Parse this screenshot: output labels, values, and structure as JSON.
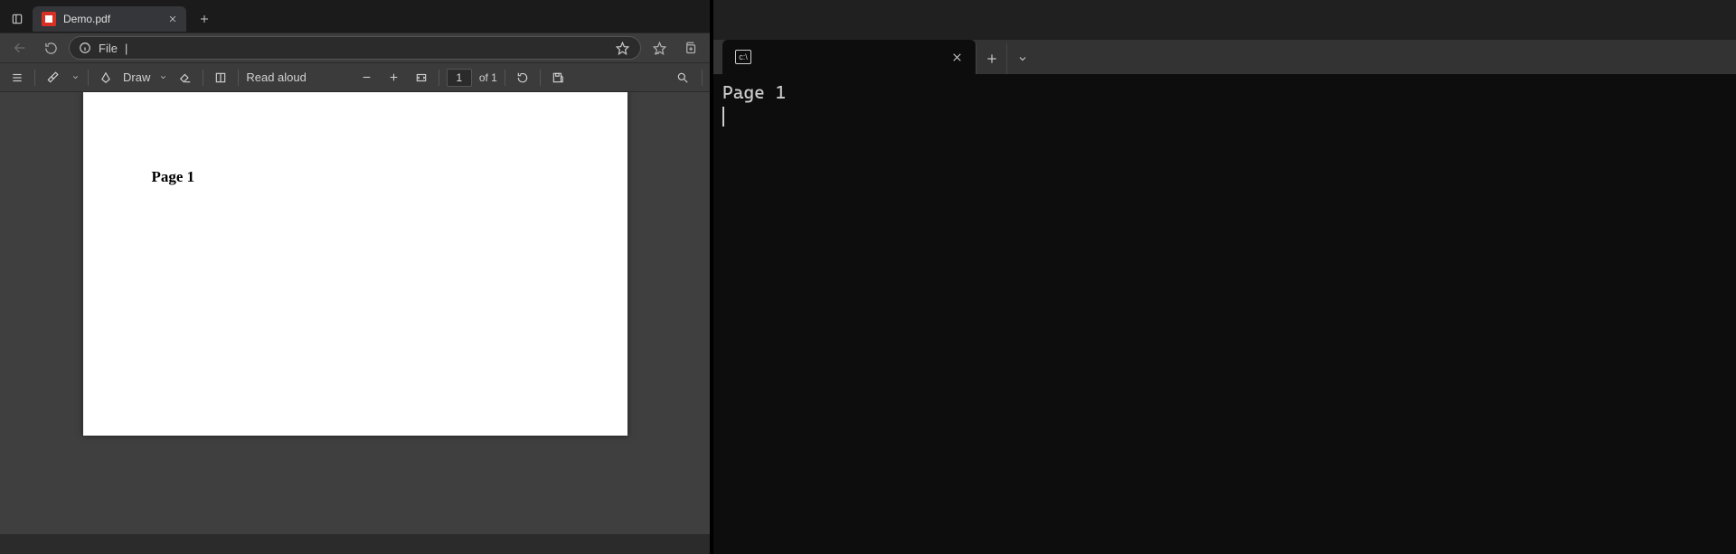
{
  "browser": {
    "tab": {
      "title": "Demo.pdf"
    },
    "address": {
      "scheme_label": "File",
      "bar_text": "|"
    },
    "pdf_toolbar": {
      "draw_label": "Draw",
      "read_aloud_label": "Read aloud",
      "page_input_value": "1",
      "page_total_label": "of 1"
    },
    "pdf_content": {
      "heading": "Page 1"
    }
  },
  "terminal": {
    "output_line_1": "Page 1"
  }
}
